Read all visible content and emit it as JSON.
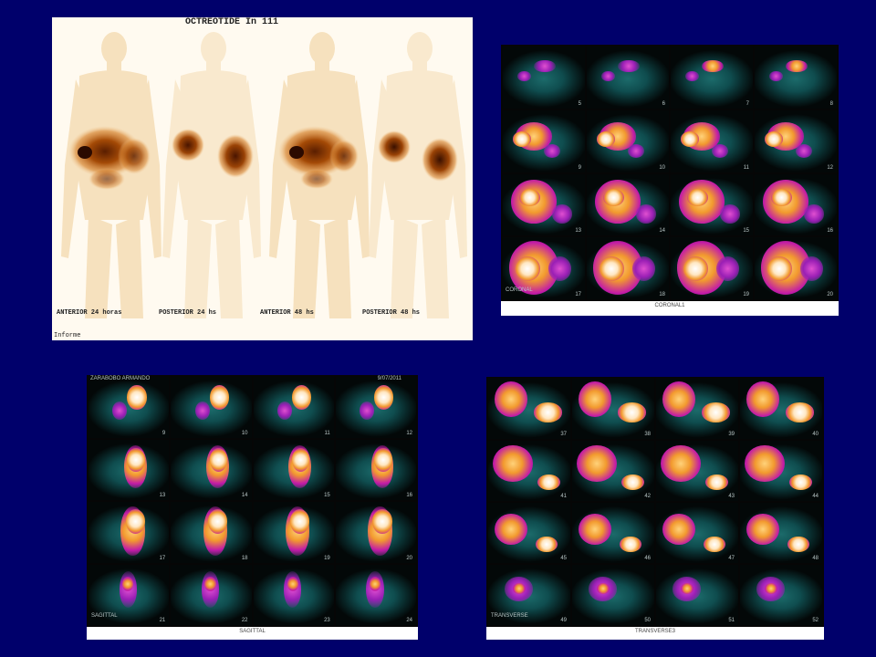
{
  "planar": {
    "title": "OCTREOTIDE In 111",
    "views": [
      {
        "label": "ANTERIOR   24 horas"
      },
      {
        "label": "POSTERIOR   24 hs"
      },
      {
        "label": "ANTERIOR   48 hs"
      },
      {
        "label": "POSTERIOR   48 hs"
      }
    ],
    "footer": "Informe"
  },
  "coronal": {
    "caption": "CORONAL1",
    "corner_label": "CORONAL",
    "slices": [
      "5",
      "6",
      "7",
      "8",
      "9",
      "10",
      "11",
      "12",
      "13",
      "14",
      "15",
      "16",
      "17",
      "18",
      "19",
      "20"
    ]
  },
  "sagittal": {
    "caption": "SAGITTAL",
    "corner_label": "SAGITTAL",
    "header_left": "ZARABOBO ARMANDO",
    "header_right": "9/07/2011",
    "slices": [
      "9",
      "10",
      "11",
      "12",
      "13",
      "14",
      "15",
      "16",
      "17",
      "18",
      "19",
      "20",
      "21",
      "22",
      "23",
      "24"
    ]
  },
  "transverse": {
    "caption": "TRANSVERSE3",
    "corner_label": "TRANSVERSE",
    "slices": [
      "37",
      "38",
      "39",
      "40",
      "41",
      "42",
      "43",
      "44",
      "45",
      "46",
      "47",
      "48",
      "49",
      "50",
      "51",
      "52"
    ]
  },
  "colors": {
    "slide_background": "#00006b",
    "planar_uptake": "#8a3a00",
    "spect_background": "#0f4d4f",
    "spect_hot": "#ffffff",
    "spect_warm": "#f29a2e",
    "spect_mid": "#c21aa8"
  }
}
